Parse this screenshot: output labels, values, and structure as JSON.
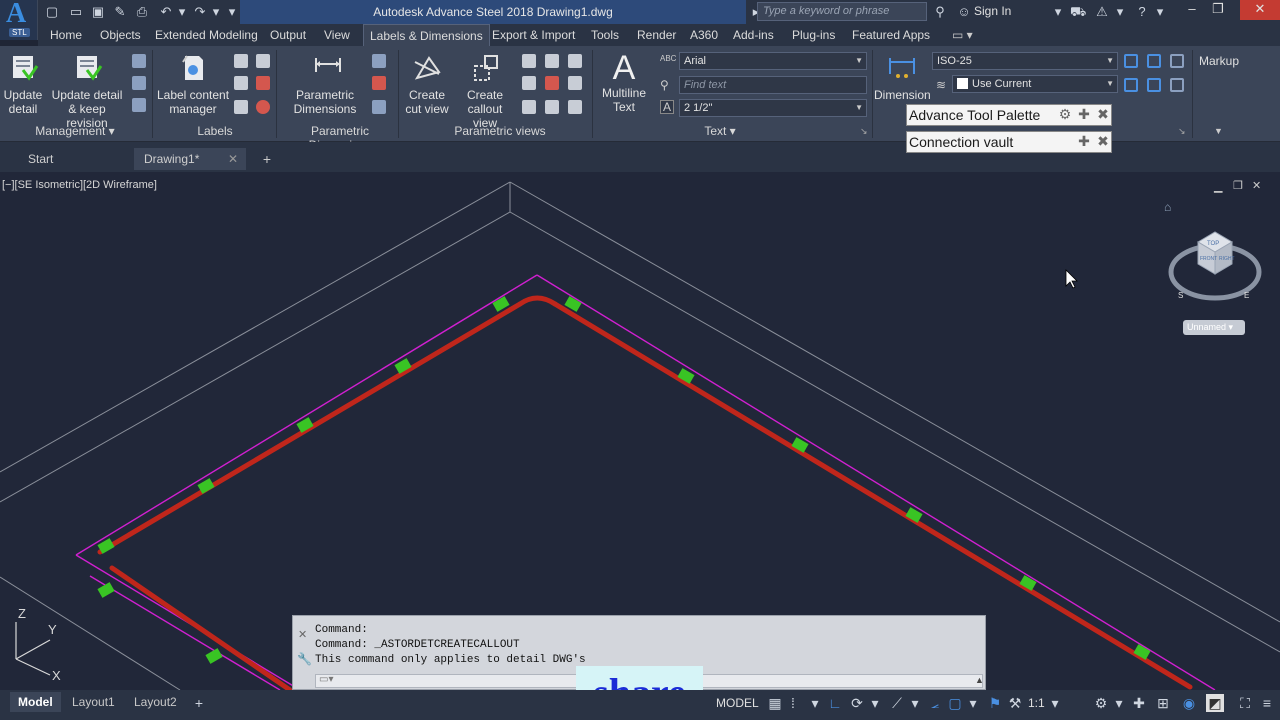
{
  "app": {
    "title": "Autodesk Advance Steel 2018   Drawing1.dwg",
    "logo_text": "STL"
  },
  "search": {
    "placeholder": "Type a keyword or phrase"
  },
  "signin": {
    "label": "Sign In"
  },
  "menu_tabs": [
    "Home",
    "Objects",
    "Extended Modeling",
    "Output",
    "View",
    "Labels & Dimensions",
    "Export & Import",
    "Tools",
    "Render",
    "A360",
    "Add-ins",
    "Plug-ins",
    "Featured Apps"
  ],
  "active_tab": "Labels & Dimensions",
  "ribbon": {
    "update_detail": "Update detail",
    "update_keep": "Update detail & keep revision",
    "management": "Management",
    "label_content": "Label content manager",
    "labels": "Labels",
    "parametric_dims": "Parametric Dimensions",
    "parametric_dims_panel": "Parametric Dimensions",
    "create_cut": "Create cut view",
    "create_callout": "Create callout view",
    "parametric_views": "Parametric views",
    "multiline": "Multiline Text",
    "text_panel": "Text",
    "font": "Arial",
    "find_text": "Find text",
    "text_height": "2 1/2\"",
    "dimension": "Dimension",
    "dim_style": "ISO-25",
    "use_current": "Use Current",
    "markup": "Markup"
  },
  "palette": {
    "item1": "Advance Tool Palette",
    "item2": "Connection vault"
  },
  "file_tabs": {
    "start": "Start",
    "drawing": "Drawing1*"
  },
  "viewport": {
    "label": "[−][SE Isometric][2D Wireframe]",
    "viewcube_unnamed": "Unnamed",
    "viewcube_top": "TOP",
    "viewcube_front": "FRONT",
    "viewcube_right": "RIGHT"
  },
  "command": {
    "lines": [
      "Command:",
      "Command: _ASTORDETCREATECALLOUT",
      "This command only applies to detail DWG's"
    ]
  },
  "share_label": "share",
  "status": {
    "model_tab": "Model",
    "layout1": "Layout1",
    "layout2": "Layout2",
    "model_btn": "MODEL",
    "scale": "1:1"
  },
  "colors": {
    "accent": "#2d4a7a",
    "beam": "#c0261b",
    "outline": "#d020d0",
    "connection": "#39c424",
    "grid": "#8a8f9a"
  }
}
